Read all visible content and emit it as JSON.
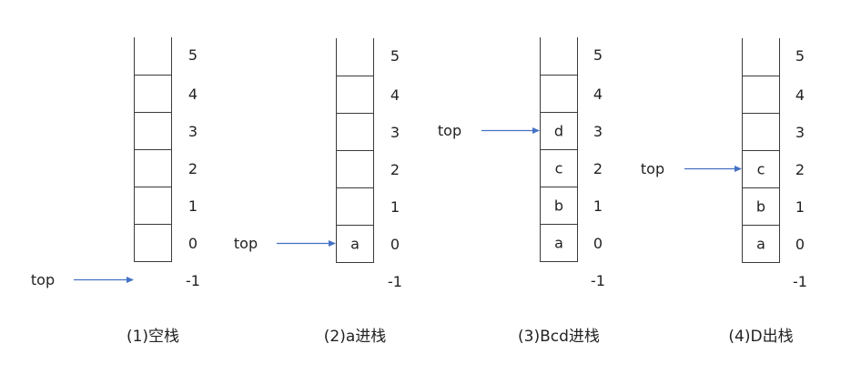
{
  "index_labels": [
    "5",
    "4",
    "3",
    "2",
    "1",
    "0",
    "-1"
  ],
  "top_label": "top",
  "colors": {
    "cell_border": "#3a3a3a",
    "arrow": "#4472c4",
    "text": "#222222"
  },
  "stacks": [
    {
      "caption": "(1)空栈",
      "top_index": -1,
      "cells": [
        "",
        "",
        "",
        "",
        "",
        ""
      ]
    },
    {
      "caption": "(2)a进栈",
      "top_index": 0,
      "cells": [
        "a",
        "",
        "",
        "",
        "",
        ""
      ]
    },
    {
      "caption": "(3)Bcd进栈",
      "top_index": 3,
      "cells": [
        "a",
        "b",
        "c",
        "d",
        "",
        ""
      ]
    },
    {
      "caption": "(4)D出栈",
      "top_index": 2,
      "cells": [
        "a",
        "b",
        "c",
        "",
        "",
        ""
      ]
    }
  ]
}
